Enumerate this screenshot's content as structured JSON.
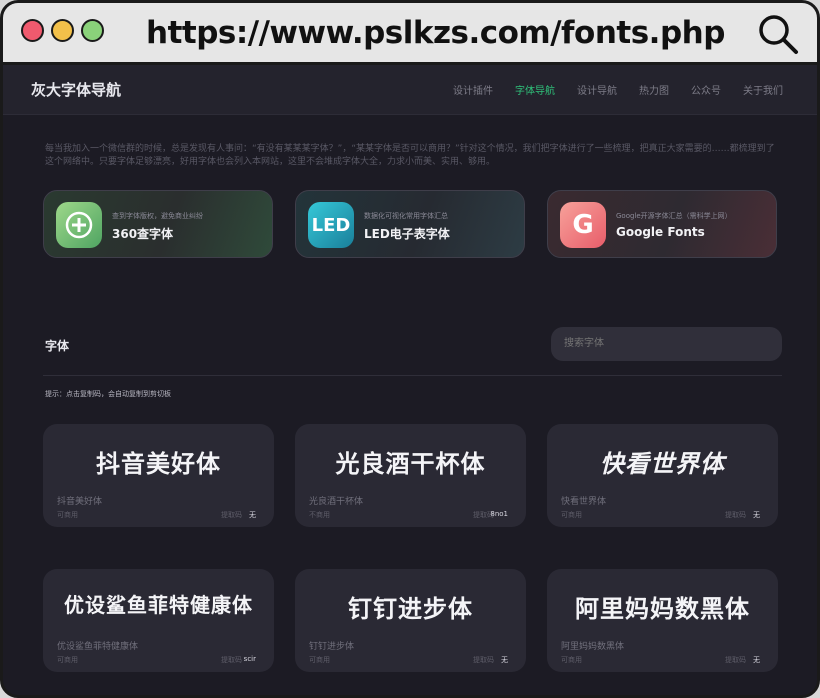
{
  "browser": {
    "url": "https://www.pslkzs.com/fonts.php"
  },
  "header": {
    "brand": "灰大字体导航",
    "nav": [
      "设计插件",
      "字体导航",
      "设计导航",
      "热力图",
      "公众号",
      "关于我们"
    ]
  },
  "intro": "每当我加入一个微信群的时候，总是发现有人事问：“有没有某某某字体？”，“某某字体是否可以商用？”针对这个情况，我们把字体进行了一些梳理，把真正大家需要的……都梳理到了这个网络中。只要字体足够漂亮，好用字体也会列入本网站，这里不会堆成字体大全，力求小而美、实用、够用。",
  "featured": [
    {
      "sub": "查到字体版权，避免商业纠纷",
      "name": "360查字体",
      "icon": "360-plus-icon",
      "logo": "+"
    },
    {
      "sub": "数据化可视化常用字体汇总",
      "name": "LED电子表字体",
      "icon": "led-icon",
      "logo": "LED"
    },
    {
      "sub": "Google开源字体汇总（需科学上网）",
      "name": "Google Fonts",
      "icon": "google-g-icon",
      "logo": "G"
    }
  ],
  "section": {
    "title": "字体",
    "search_placeholder": "搜索字体",
    "tip": "提示：点击复制码，会自动复制到剪切板"
  },
  "fonts": [
    {
      "preview": "抖音美好体",
      "name": "抖音美好体",
      "usage": "可商用",
      "code_label": "提取码",
      "code": "无"
    },
    {
      "preview": "光良酒干杯体",
      "name": "光良酒干杯体",
      "usage": "不商用",
      "code_label": "提取码",
      "code": "8no1"
    },
    {
      "preview": "快看世界体",
      "name": "快看世界体",
      "usage": "可商用",
      "code_label": "提取码",
      "code": "无"
    },
    {
      "preview": "优设鲨鱼菲特健康体",
      "name": "优设鲨鱼菲特健康体",
      "usage": "可商用",
      "code_label": "提取码",
      "code": "scir"
    },
    {
      "preview": "钉钉进步体",
      "name": "钉钉进步体",
      "usage": "可商用",
      "code_label": "提取码",
      "code": "无"
    },
    {
      "preview": "阿里妈妈数黑体",
      "name": "阿里妈妈数黑体",
      "usage": "可商用",
      "code_label": "提取码",
      "code": "无"
    }
  ]
}
